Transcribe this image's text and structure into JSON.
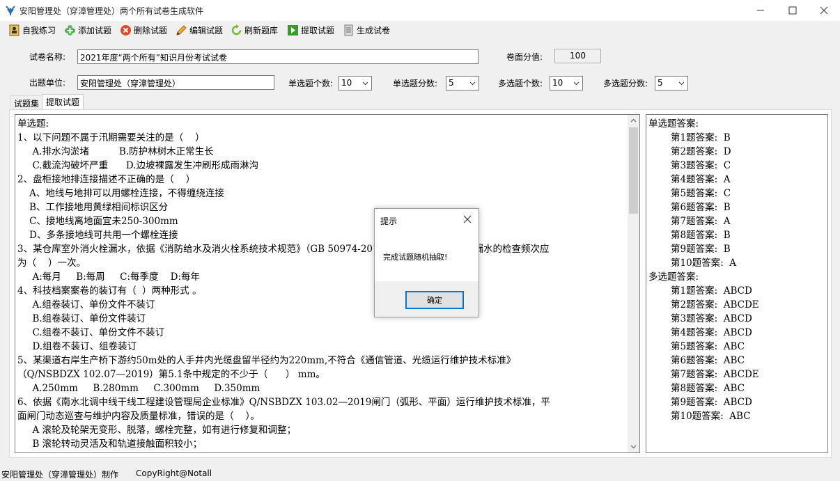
{
  "window": {
    "title": "安阳管理处（穿漳管理处）两个所有试卷生成软件",
    "minimize_icon": "minimize-icon",
    "maximize_icon": "maximize-icon",
    "close_icon": "close-icon"
  },
  "toolbar": {
    "items": [
      {
        "label": "自我练习",
        "icon": "person-book-icon"
      },
      {
        "label": "添加试题",
        "icon": "add-clover-icon"
      },
      {
        "label": "删除试题",
        "icon": "delete-x-icon"
      },
      {
        "label": "编辑试题",
        "icon": "pencil-icon"
      },
      {
        "label": "刷新题库",
        "icon": "refresh-icon"
      },
      {
        "label": "提取试题",
        "icon": "play-arrow-icon"
      },
      {
        "label": "生成试卷",
        "icon": "document-icon"
      }
    ]
  },
  "form": {
    "exam_name_label": "试卷名称:",
    "exam_name_value": "2021年度“两个所有”知识月份考试试卷",
    "total_score_label": "卷面分值:",
    "total_score_value": "100",
    "unit_label": "出题单位:",
    "unit_value": "安阳管理处（穿漳管理处）",
    "single_count_label": "单选题个数:",
    "single_count_value": "10",
    "single_score_label": "单选题分数:",
    "single_score_value": "5",
    "multi_count_label": "多选题个数:",
    "multi_count_value": "10",
    "multi_score_label": "多选题分数:",
    "multi_score_value": "5"
  },
  "tabs": [
    {
      "label": "试题集",
      "active": false
    },
    {
      "label": "提取试题",
      "active": true
    }
  ],
  "questions_text": "单选题:\n1、以下问题不属于汛期需要关注的是（    ）\n     A.排水沟淤堵          B.防护林树木正常生长\n     C.截流沟破坏严重      D.边坡裸露发生冲刷形成雨淋沟\n2、盘柜接地排连接描述不正确的是（    ）\n    A、地线与地排可以用螺栓连接，不得缠绕连接\n    B、工作接地用黄绿相间标识区分\n    C、接地线离地面宜未250-300mm\n    D、多条接地线可共用一个螺栓连接\n3、某仓库室外消火栓漏水，依据《消防给水及消火栓系统技术规范》（GB 50974-2014），室外消火栓外观和漏水的检查频次应\n为（    ）一次。\n     A:每月     B:每周     C:每季度    D:每年\n4、科技档案案卷的装订有（  ）两种形式 。\n     A.组卷装订、单份文件不装订\n     B.组卷装订、单份文件装订\n     C.组卷不装订、单份文件不装订\n     D.组卷不装订、组卷装订\n5、某渠道右岸生产桥下游约50m处的人手井内光缆盘留半径约为220mm,不符合《通信管道、光缆运行维护技术标准》\n（Q/NSBDZX 102.07—2019）第5.1条中规定的不少于（      ） mm。\n     A.250mm     B.280mm     C.300mm     D.350mm\n6、依据《南水北调中线干线工程建设管理局企业标准》Q/NSBDZX 103.02—2019闸门（弧形、平面）运行维护技术标准，平\n面闸门动态巡查与维护内容及质量标准，错误的是（    ）。\n     A 滚轮及轮架无变形、脱落，螺栓完整，如有进行修复和调整；\n     B 滚轮转动灵活及和轨道接触面积较小；\n     C 滑块和侧向支承完好，如有破损应进行修复或更换；",
  "answers": {
    "single_header": "单选题答案:",
    "single": [
      "第1题答案:  B",
      "第2题答案:  D",
      "第3题答案:  C",
      "第4题答案:  A",
      "第5题答案:  C",
      "第6题答案:  B",
      "第7题答案:  A",
      "第8题答案:  B",
      "第9题答案:  B",
      "第10题答案:  A"
    ],
    "multi_header": "多选题答案:",
    "multi": [
      "第1题答案:  ABCD",
      "第2题答案:  ABCDE",
      "第3题答案:  ABCD",
      "第4题答案:  ABCD",
      "第5题答案:  ABC",
      "第6题答案:  ABC",
      "第7题答案:  ABCDE",
      "第8题答案:  ABC",
      "第9题答案:  ABCD",
      "第10题答案:  ABC"
    ]
  },
  "dialog": {
    "title": "提示",
    "message": "完成试题随机抽取!",
    "ok_label": "确定"
  },
  "status": {
    "maker": "安阳管理处（穿漳管理处）制作",
    "copyright": "CopyRight@Notall"
  }
}
